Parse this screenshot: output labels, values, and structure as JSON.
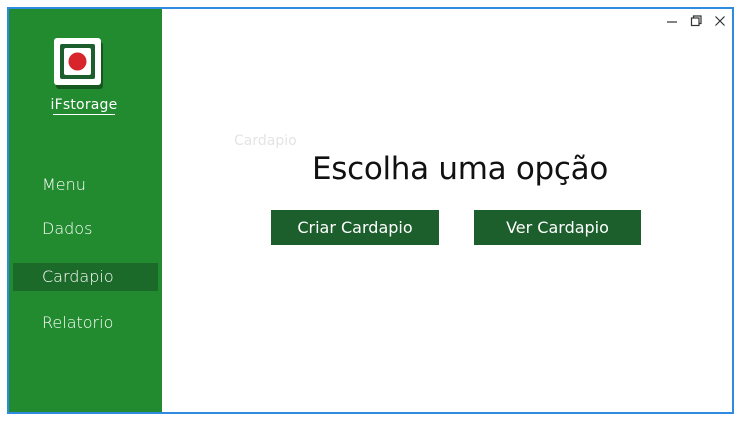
{
  "app": {
    "logo_text": "iFstorage"
  },
  "sidebar": {
    "items": [
      {
        "label": "Menu"
      },
      {
        "label": "Dados"
      },
      {
        "label": "Cardapio",
        "active": true
      },
      {
        "label": "Relatorio"
      }
    ]
  },
  "content": {
    "ghost_title": "Cardapio",
    "heading": "Escolha uma opção",
    "buttons": {
      "create": "Criar Cardapio",
      "view": "Ver Cardapio"
    }
  },
  "window_controls": [
    "minimize-icon",
    "restore-icon",
    "close-icon"
  ],
  "colors": {
    "sidebar": "#228b30",
    "sidebar_active": "#1c6a2a",
    "button": "#1c5f2c",
    "window_border": "#2f8be0",
    "logo_red": "#d8252c"
  }
}
